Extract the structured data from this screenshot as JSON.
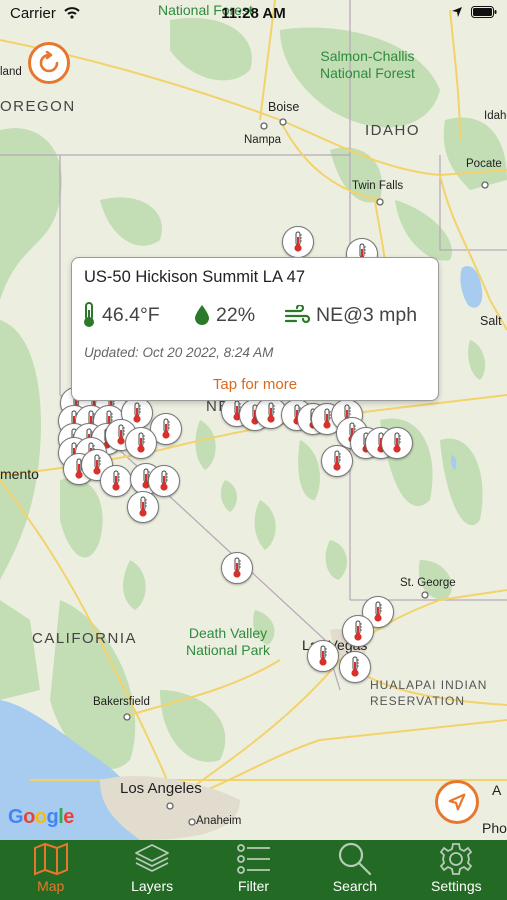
{
  "status": {
    "carrier": "Carrier",
    "time": "11:28 AM"
  },
  "map": {
    "labels": {
      "oregon": "OREGON",
      "idaho": "IDAHO",
      "california": "CALIFORNIA",
      "nv_partial": "NE",
      "land_partial": "land",
      "salmon_challis": "Salmon-Challis\nNational Forest",
      "national_top": "National Forest",
      "death_valley": "Death Valley\nNational Park",
      "boise": "Boise",
      "nampa": "Nampa",
      "twin_falls": "Twin Falls",
      "pocatello": "Pocate",
      "idaho_falls": "Idaho",
      "salt": "Salt",
      "mento": "mento",
      "st_george": "St. George",
      "las_vegas": "Las Vegas",
      "hualapai": "HUALAPAI INDIAN\nRESERVATION",
      "bakersfield": "Bakersfield",
      "los_angeles": "Los Angeles",
      "anaheim": "Anaheim",
      "pho": "Pho",
      "a_partial": "A"
    },
    "google_logo": [
      "G",
      "o",
      "o",
      "g",
      "l",
      "e"
    ],
    "colors": {
      "accent": "#e8772e",
      "tabbar": "#236a24",
      "thermo": "#d8312b"
    }
  },
  "popup": {
    "title": "US-50 Hickison Summit LA 47",
    "temperature": "46.4°F",
    "humidity": "22%",
    "wind": "NE@3 mph",
    "updated": "Updated: Oct 20 2022, 8:24 AM",
    "more": "Tap for more"
  },
  "tabs": [
    {
      "label": "Map",
      "icon": "map-icon",
      "active": true
    },
    {
      "label": "Layers",
      "icon": "layers-icon",
      "active": false
    },
    {
      "label": "Filter",
      "icon": "filter-icon",
      "active": false
    },
    {
      "label": "Search",
      "icon": "search-icon",
      "active": false
    },
    {
      "label": "Settings",
      "icon": "gear-icon",
      "active": false
    }
  ]
}
